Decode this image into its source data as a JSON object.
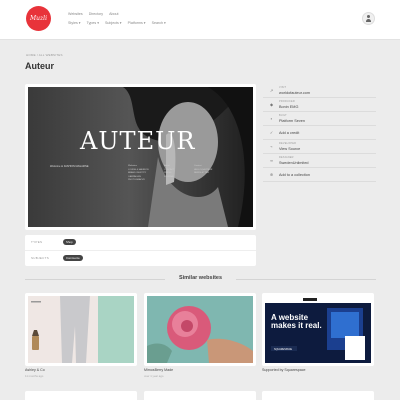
{
  "header": {
    "logo_text": "Muzli",
    "nav_primary": [
      "Websites",
      "Directory",
      "About"
    ],
    "nav_secondary": [
      "Styles",
      "Types",
      "Subjects",
      "Platforms",
      "Search"
    ]
  },
  "breadcrumb": "HOME  /  ALL WEBSITES",
  "page_title": "Auteur",
  "hero": {
    "title": "AUTEUR",
    "tagline": "Welcome to FASHION MAGAZINE",
    "col1": [
      "Websites",
      "LOUISE & MAURICE",
      "BRAND IDENTITY",
      "CAMPAIGNS",
      "PHOTOGRAPHY"
    ],
    "col2": [
      "About",
      "CONTACT",
      "PRESS",
      "JOURNAL"
    ],
    "col3": [
      "Contact",
      "HELLO@AUTEUR",
      "NEWSLETTER"
    ]
  },
  "sidebar": {
    "url_label": "VISIT",
    "url_value": "worldofauteur.com",
    "agency_label": "PRODUCER",
    "agency_value": "Bonin EMG",
    "platform_label": "BUILT",
    "platform_value": "Platform Seven",
    "credit_label": "Add a credit",
    "source_label": "DEVELOPER",
    "source_value": "View Source",
    "studio_label": "DESIGNER",
    "studio_value": "SwedenUnlimited",
    "collection_label": "Add to a collection"
  },
  "meta": {
    "type_label": "TYPES",
    "type_value": "Shop",
    "subject_label": "SUBJECTS",
    "subject_value": "Commerce"
  },
  "similar": {
    "title": "Similar websites",
    "items": [
      {
        "name": "Ashley & Co",
        "meta": "11 months ago"
      },
      {
        "name": "MimosBerry Made",
        "meta": "over 1 year ago"
      },
      {
        "name": "Supported by Squarespace",
        "meta": ""
      }
    ],
    "ad_headline": "A website makes it real.",
    "ad_brand": "SQUARESPACE"
  }
}
